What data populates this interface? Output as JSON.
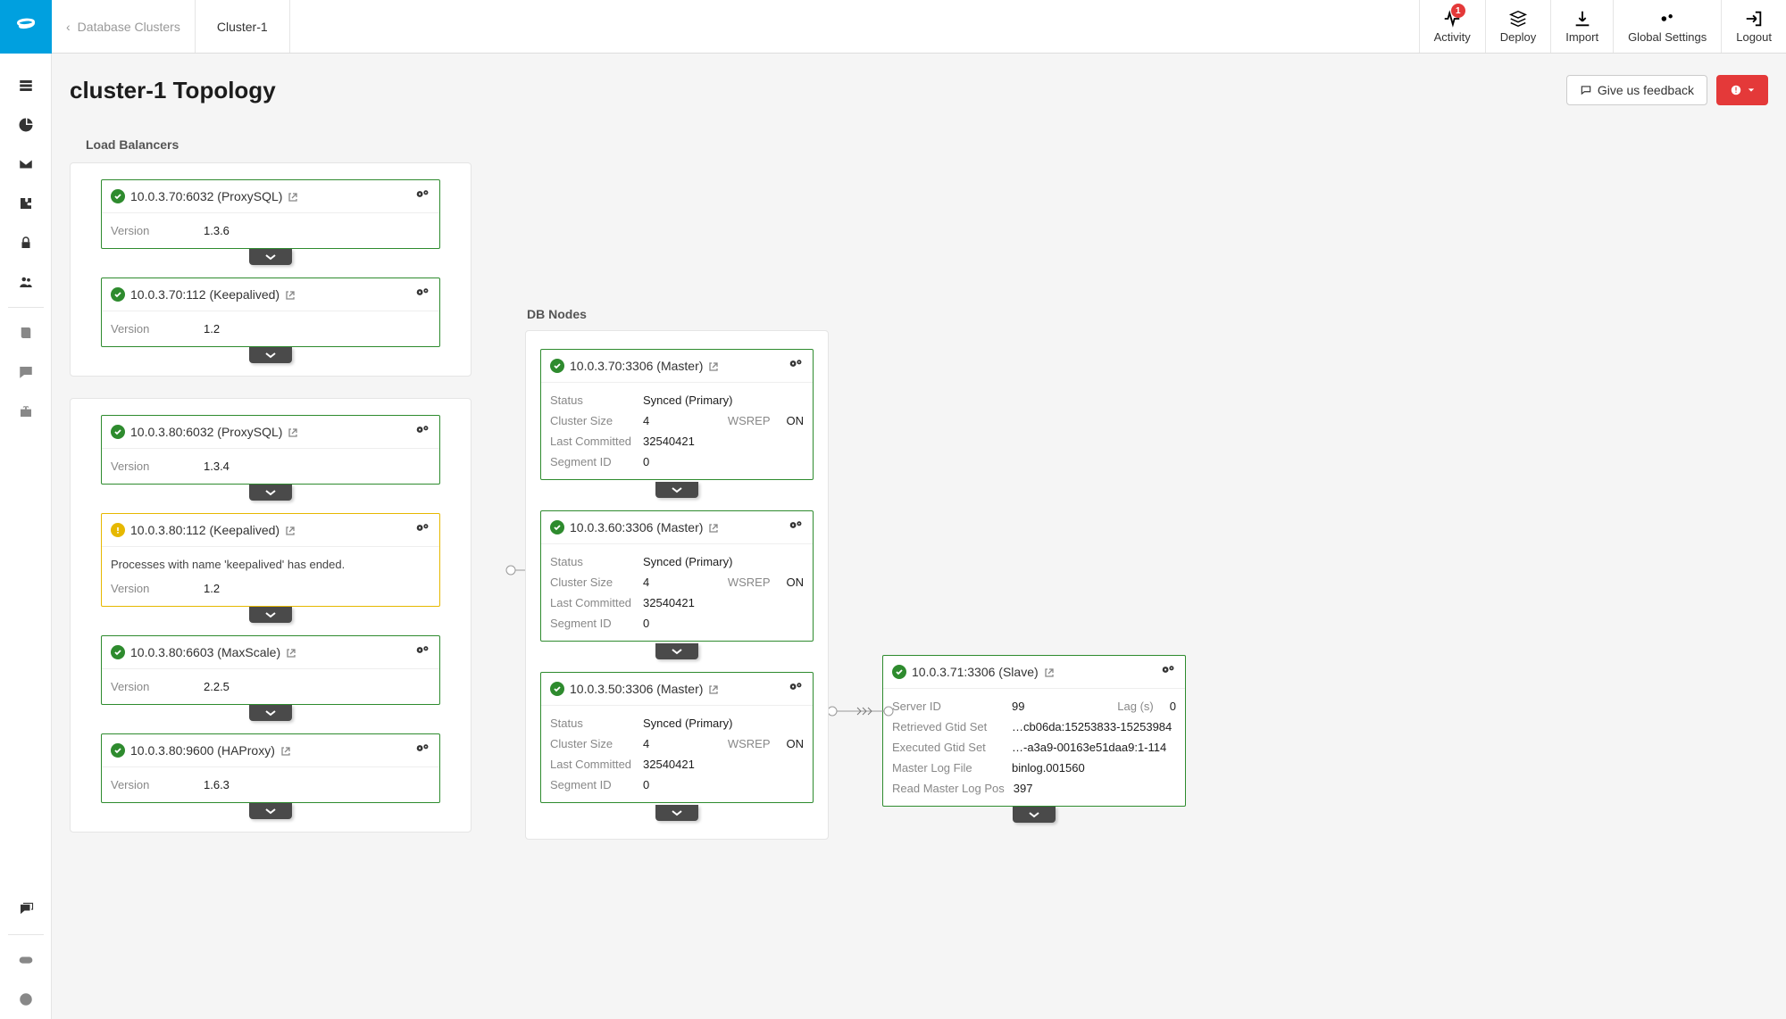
{
  "header": {
    "breadcrumb_parent": "Database Clusters",
    "breadcrumb_current": "Cluster-1",
    "activity_badge": "1",
    "actions": {
      "activity": "Activity",
      "deploy": "Deploy",
      "import": "Import",
      "global_settings": "Global Settings",
      "logout": "Logout"
    }
  },
  "page": {
    "title": "cluster-1 Topology",
    "feedback_label": "Give us feedback"
  },
  "labels": {
    "load_balancers": "Load Balancers",
    "db_nodes": "DB Nodes",
    "version": "Version",
    "status": "Status",
    "cluster_size": "Cluster Size",
    "wsrep": "WSREP",
    "last_committed": "Last Committed",
    "segment_id": "Segment ID",
    "server_id": "Server ID",
    "lag": "Lag (s)",
    "retrieved_gtid": "Retrieved Gtid Set",
    "executed_gtid": "Executed Gtid Set",
    "master_log_file": "Master Log File",
    "read_master_log_pos": "Read Master Log Pos"
  },
  "lb_groups": [
    {
      "nodes": [
        {
          "status": "ok",
          "title": "10.0.3.70:6032 (ProxySQL)",
          "version": "1.3.6"
        },
        {
          "status": "ok",
          "title": "10.0.3.70:112 (Keepalived)",
          "version": "1.2"
        }
      ]
    },
    {
      "nodes": [
        {
          "status": "ok",
          "title": "10.0.3.80:6032 (ProxySQL)",
          "version": "1.3.4"
        },
        {
          "status": "warn",
          "title": "10.0.3.80:112 (Keepalived)",
          "message": "Processes with name 'keepalived' has ended.",
          "version": "1.2"
        },
        {
          "status": "ok",
          "title": "10.0.3.80:6603 (MaxScale)",
          "version": "2.2.5"
        },
        {
          "status": "ok",
          "title": "10.0.3.80:9600 (HAProxy)",
          "version": "1.6.3"
        }
      ]
    }
  ],
  "db_nodes": [
    {
      "status": "ok",
      "title": "10.0.3.70:3306 (Master)",
      "sync_status": "Synced (Primary)",
      "cluster_size": "4",
      "wsrep": "ON",
      "last_committed": "32540421",
      "segment_id": "0"
    },
    {
      "status": "ok",
      "title": "10.0.3.60:3306 (Master)",
      "sync_status": "Synced (Primary)",
      "cluster_size": "4",
      "wsrep": "ON",
      "last_committed": "32540421",
      "segment_id": "0"
    },
    {
      "status": "ok",
      "title": "10.0.3.50:3306 (Master)",
      "sync_status": "Synced (Primary)",
      "cluster_size": "4",
      "wsrep": "ON",
      "last_committed": "32540421",
      "segment_id": "0"
    }
  ],
  "slave": {
    "status": "ok",
    "title": "10.0.3.71:3306 (Slave)",
    "server_id": "99",
    "lag": "0",
    "retrieved_gtid": "…cb06da:15253833-15253984",
    "executed_gtid": "…-a3a9-00163e51daa9:1-114",
    "master_log_file": "binlog.001560",
    "read_master_log_pos": "397"
  }
}
